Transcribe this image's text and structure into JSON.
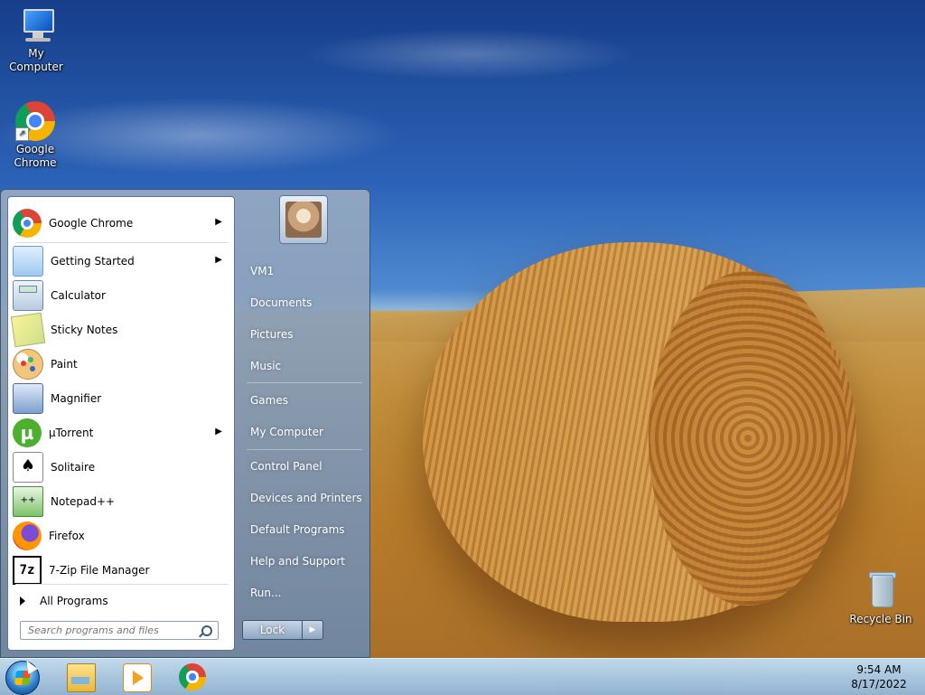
{
  "desktop": {
    "icons": [
      {
        "label": "My Computer",
        "icon": "computer-icon"
      },
      {
        "label": "Google Chrome",
        "icon": "chrome-icon"
      },
      {
        "label": "Recycle Bin",
        "icon": "recycle-bin-icon"
      }
    ]
  },
  "start_menu": {
    "programs": [
      {
        "label": "Google Chrome",
        "icon": "chrome-icon",
        "submenu": true
      },
      {
        "label": "Getting Started",
        "icon": "getting-started-icon",
        "submenu": true
      },
      {
        "label": "Calculator",
        "icon": "calculator-icon",
        "submenu": false
      },
      {
        "label": "Sticky Notes",
        "icon": "sticky-notes-icon",
        "submenu": false
      },
      {
        "label": "Paint",
        "icon": "paint-icon",
        "submenu": false
      },
      {
        "label": "Magnifier",
        "icon": "magnifier-icon",
        "submenu": false
      },
      {
        "label": "µTorrent",
        "icon": "utorrent-icon",
        "submenu": true
      },
      {
        "label": "Solitaire",
        "icon": "solitaire-icon",
        "submenu": false
      },
      {
        "label": "Notepad++",
        "icon": "notepad-plus-plus-icon",
        "submenu": false
      },
      {
        "label": "Firefox",
        "icon": "firefox-icon",
        "submenu": false
      },
      {
        "label": "7-Zip File Manager",
        "icon": "7zip-icon",
        "submenu": false
      }
    ],
    "all_programs": "All Programs",
    "search_placeholder": "Search programs and files",
    "right_items": {
      "user": "VM1",
      "documents": "Documents",
      "pictures": "Pictures",
      "music": "Music",
      "games": "Games",
      "my_computer": "My Computer",
      "control_panel": "Control Panel",
      "devices_printers": "Devices and Printers",
      "default_programs": "Default Programs",
      "help_support": "Help and Support",
      "run": "Run..."
    },
    "lock_label": "Lock"
  },
  "taskbar": {
    "pinned": [
      "file-explorer-icon",
      "media-player-icon",
      "chrome-icon"
    ],
    "time": "9:54 AM",
    "date": "8/17/2022"
  }
}
